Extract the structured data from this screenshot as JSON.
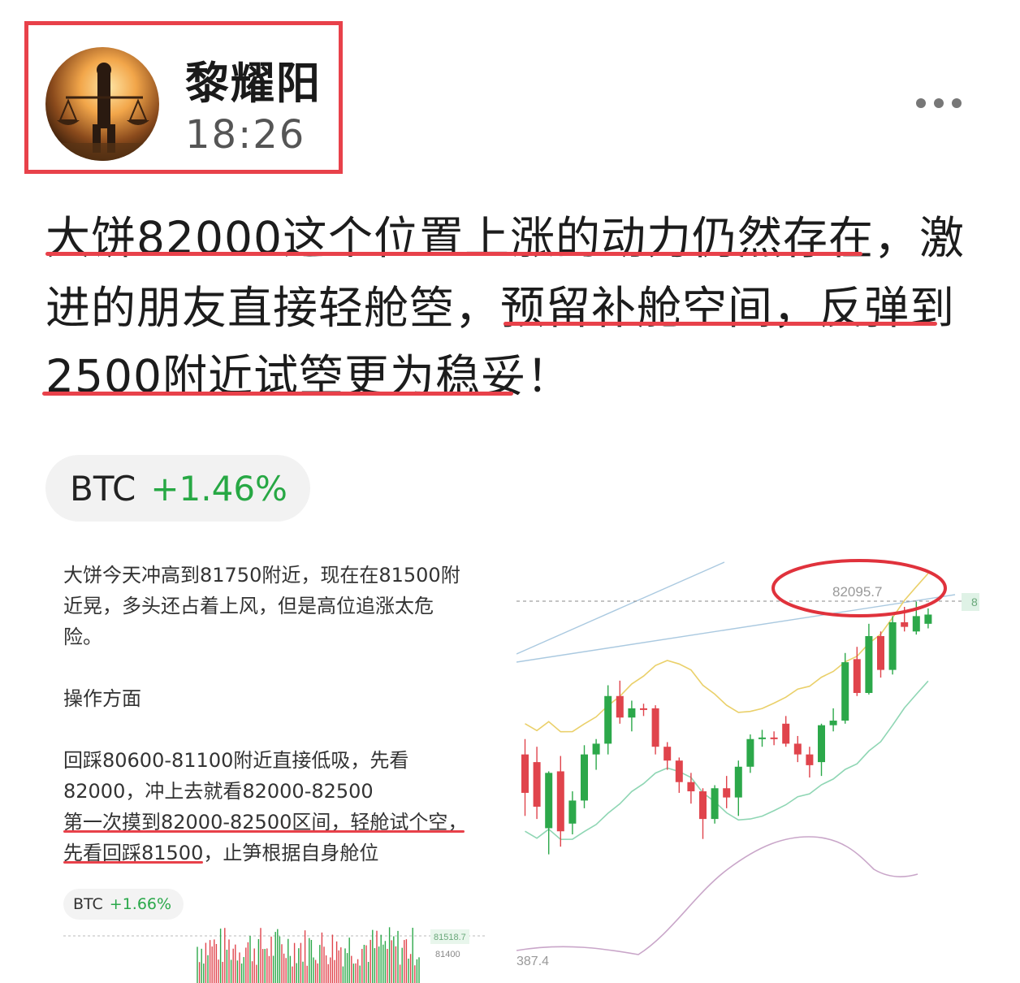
{
  "header": {
    "name": "黎耀阳",
    "time": "18:26"
  },
  "post": {
    "lines": [
      "大饼82000这个位置上涨的动力仍然存在，激",
      "进的朋友直接轻舱箜，预留补舱空间，反弹到",
      "2500附近试箜更为稳妥！"
    ]
  },
  "ticker_chip": {
    "symbol": "BTC",
    "change": "+1.46%"
  },
  "embedded_post": {
    "lines": [
      "大饼今天冲高到81750附近，现在在81500附",
      "近晃，多头还占着上风，但是高位追涨太危",
      "险。",
      "操作方面",
      "回踩80600-81100附近直接低吸，先看",
      "82000，冲上去就看82000-82500",
      "第一次摸到82000-82500区间，轻舱试个空，",
      "先看回踩81500，止笋根据自身舱位"
    ],
    "chip": {
      "symbol": "BTC",
      "change": "+1.66%"
    },
    "mini_chart_labels": {
      "price_tag": "81518.7",
      "level": "81400"
    }
  },
  "chart_data": {
    "type": "candlestick",
    "annotation": "82095.7",
    "bottom_label": "387.4",
    "right_label": "8",
    "colors": {
      "up": "#2ca84a",
      "down": "#e0444c",
      "ma_yellow": "#ead06a",
      "ma_green": "#8fd6b4",
      "line_purple": "#c9a6c9"
    },
    "candles": [
      {
        "o": 81100,
        "h": 81200,
        "l": 80700,
        "c": 80850
      },
      {
        "o": 81050,
        "h": 81150,
        "l": 80680,
        "c": 80760
      },
      {
        "o": 80620,
        "h": 80990,
        "l": 80450,
        "c": 80980
      },
      {
        "o": 80990,
        "h": 81090,
        "l": 80500,
        "c": 80600
      },
      {
        "o": 80650,
        "h": 80860,
        "l": 80580,
        "c": 80800
      },
      {
        "o": 80800,
        "h": 81160,
        "l": 80750,
        "c": 81100
      },
      {
        "o": 81100,
        "h": 81200,
        "l": 81000,
        "c": 81170
      },
      {
        "o": 81170,
        "h": 81550,
        "l": 81100,
        "c": 81480
      },
      {
        "o": 81480,
        "h": 81580,
        "l": 81300,
        "c": 81340
      },
      {
        "o": 81340,
        "h": 81450,
        "l": 81250,
        "c": 81400
      },
      {
        "o": 81400,
        "h": 81430,
        "l": 81350,
        "c": 81390
      },
      {
        "o": 81400,
        "h": 81420,
        "l": 81100,
        "c": 81150
      },
      {
        "o": 81150,
        "h": 81180,
        "l": 81000,
        "c": 81060
      },
      {
        "o": 81060,
        "h": 81080,
        "l": 80850,
        "c": 80920
      },
      {
        "o": 80920,
        "h": 80980,
        "l": 80780,
        "c": 80860
      },
      {
        "o": 80860,
        "h": 80880,
        "l": 80550,
        "c": 80680
      },
      {
        "o": 80680,
        "h": 80900,
        "l": 80650,
        "c": 80880
      },
      {
        "o": 80880,
        "h": 80960,
        "l": 80750,
        "c": 80820
      },
      {
        "o": 80820,
        "h": 81060,
        "l": 80700,
        "c": 81020
      },
      {
        "o": 81020,
        "h": 81230,
        "l": 80980,
        "c": 81200
      },
      {
        "o": 81200,
        "h": 81260,
        "l": 81150,
        "c": 81210
      },
      {
        "o": 81210,
        "h": 81250,
        "l": 81160,
        "c": 81200
      },
      {
        "o": 81300,
        "h": 81350,
        "l": 81150,
        "c": 81170
      },
      {
        "o": 81170,
        "h": 81220,
        "l": 81050,
        "c": 81100
      },
      {
        "o": 81100,
        "h": 81150,
        "l": 80950,
        "c": 81030
      },
      {
        "o": 81050,
        "h": 81300,
        "l": 80960,
        "c": 81290
      },
      {
        "o": 81290,
        "h": 81400,
        "l": 81250,
        "c": 81320
      },
      {
        "o": 81320,
        "h": 81760,
        "l": 81300,
        "c": 81700
      },
      {
        "o": 81720,
        "h": 81800,
        "l": 81480,
        "c": 81500
      },
      {
        "o": 81500,
        "h": 81950,
        "l": 81490,
        "c": 81870
      },
      {
        "o": 81870,
        "h": 81900,
        "l": 81600,
        "c": 81650
      },
      {
        "o": 81650,
        "h": 82000,
        "l": 81620,
        "c": 81960
      },
      {
        "o": 81960,
        "h": 82060,
        "l": 81900,
        "c": 81930
      },
      {
        "o": 81900,
        "h": 82095,
        "l": 81880,
        "c": 82000
      },
      {
        "o": 81950,
        "h": 82050,
        "l": 81920,
        "c": 82010
      }
    ]
  }
}
